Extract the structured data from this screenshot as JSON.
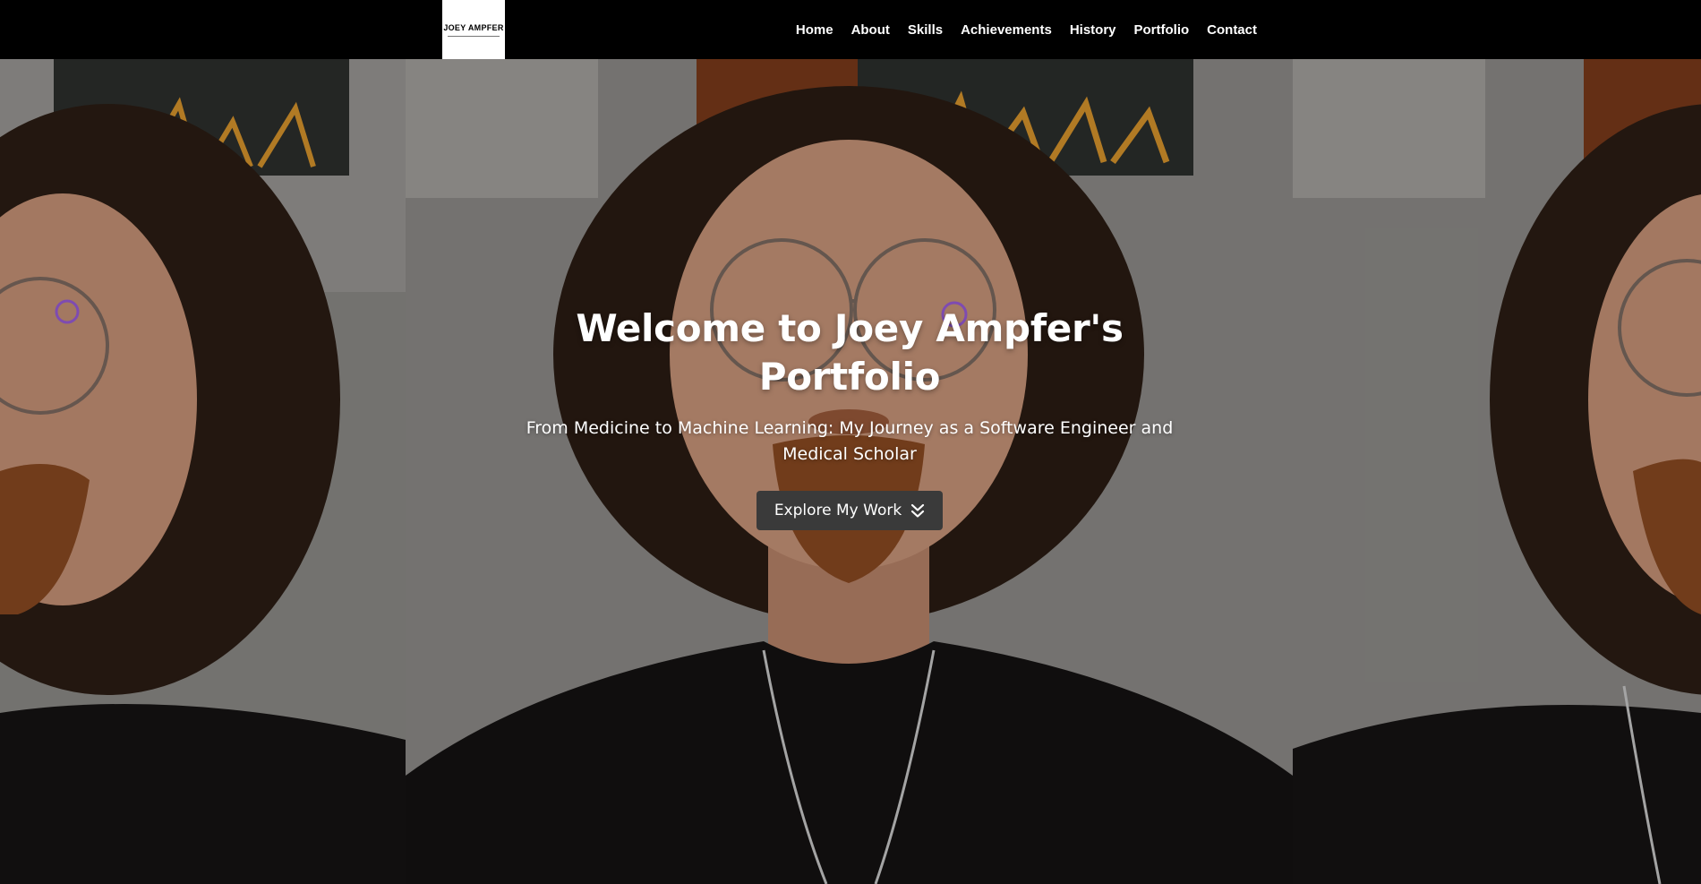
{
  "logo": {
    "text": "JOEY AMPFER"
  },
  "nav": {
    "items": [
      {
        "label": "Home"
      },
      {
        "label": "About"
      },
      {
        "label": "Skills"
      },
      {
        "label": "Achievements"
      },
      {
        "label": "History"
      },
      {
        "label": "Portfolio"
      },
      {
        "label": "Contact"
      }
    ]
  },
  "hero": {
    "title": "Welcome to Joey Ampfer's Portfolio",
    "subtitle": "From Medicine to Machine Learning: My Journey as a Software Engineer and Medical Scholar",
    "cta_label": "Explore My Work",
    "cta_icon": "double-chevron-down-icon",
    "background_image": "portrait-photo"
  },
  "colors": {
    "navbar_bg": "#000000",
    "button_bg": "#3a3a3a",
    "text": "#ffffff"
  }
}
